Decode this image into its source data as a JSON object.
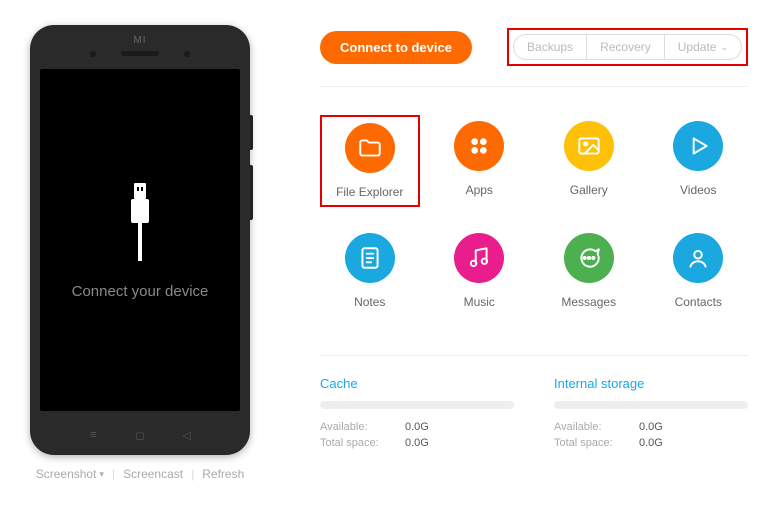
{
  "phone": {
    "brand": "MI",
    "prompt": "Connect your device"
  },
  "bottomActions": {
    "screenshot": "Screenshot",
    "screencast": "Screencast",
    "refresh": "Refresh"
  },
  "top": {
    "connect_label": "Connect to device",
    "backups": "Backups",
    "recovery": "Recovery",
    "update": "Update"
  },
  "grid": [
    {
      "label": "File Explorer",
      "color": "#ff6a00",
      "icon": "folder",
      "highlight": true
    },
    {
      "label": "Apps",
      "color": "#ff6a00",
      "icon": "apps"
    },
    {
      "label": "Gallery",
      "color": "#ffc107",
      "icon": "gallery"
    },
    {
      "label": "Videos",
      "color": "#1ba8e0",
      "icon": "video"
    },
    {
      "label": "Notes",
      "color": "#1ba8e0",
      "icon": "notes"
    },
    {
      "label": "Music",
      "color": "#e91e8c",
      "icon": "music"
    },
    {
      "label": "Messages",
      "color": "#4caf50",
      "icon": "messages"
    },
    {
      "label": "Contacts",
      "color": "#1ba8e0",
      "icon": "contacts"
    }
  ],
  "storage": {
    "cache": {
      "title": "Cache",
      "available_label": "Available:",
      "available_value": "0.0G",
      "total_label": "Total space:",
      "total_value": "0.0G"
    },
    "internal": {
      "title": "Internal storage",
      "available_label": "Available:",
      "available_value": "0.0G",
      "total_label": "Total space:",
      "total_value": "0.0G"
    }
  }
}
